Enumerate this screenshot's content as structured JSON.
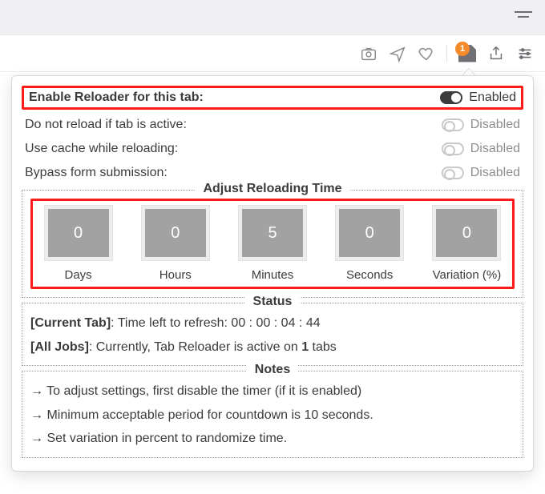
{
  "toolbar": {
    "badge_count": "1"
  },
  "settings": {
    "enable_label": "Enable Reloader for this tab:",
    "enable_state": "Enabled",
    "rows": [
      {
        "label": "Do not reload if tab is active:",
        "state": "Disabled"
      },
      {
        "label": "Use cache while reloading:",
        "state": "Disabled"
      },
      {
        "label": "Bypass form submission:",
        "state": "Disabled"
      }
    ]
  },
  "time": {
    "legend": "Adjust Reloading Time",
    "days": {
      "value": "0",
      "label": "Days"
    },
    "hours": {
      "value": "0",
      "label": "Hours"
    },
    "minutes": {
      "value": "5",
      "label": "Minutes"
    },
    "seconds": {
      "value": "0",
      "label": "Seconds"
    },
    "variation": {
      "value": "0",
      "label": "Variation (%)"
    }
  },
  "status": {
    "legend": "Status",
    "current_prefix": "[Current Tab]",
    "current_text": ": Time left to refresh: 00 : 00 : 04 : 44",
    "all_prefix": "[All Jobs]",
    "all_text_a": ": Currently, Tab Reloader is active on ",
    "all_tabs": "1",
    "all_text_b": " tabs"
  },
  "notes": {
    "legend": "Notes",
    "n1": "→ To adjust settings, first disable the timer (if it is enabled)",
    "n2": "→ Minimum acceptable period for countdown is 10 seconds.",
    "n3": "→ Set variation in percent to randomize time."
  }
}
